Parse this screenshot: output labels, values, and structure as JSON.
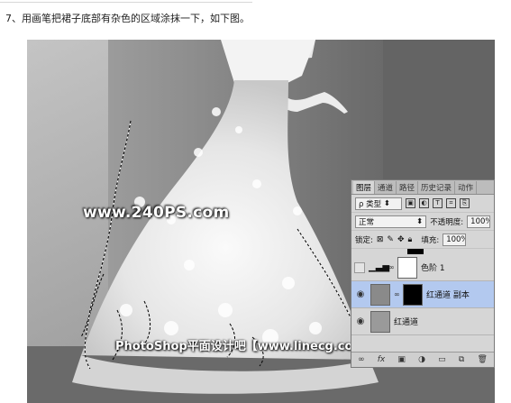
{
  "instruction": "7、用画笔把裙子底部有杂色的区域涂抹一下，如下图。",
  "watermark": "www.240PS.com",
  "footer_watermark": "PhotoShop平面设计吧【www.linecg.com/tieba/1783】",
  "panel": {
    "tabs": [
      "图层",
      "通道",
      "路径",
      "历史记录",
      "动作"
    ],
    "filter_label": "ρ 类型",
    "blend_mode": "正常",
    "opacity_label": "不透明度:",
    "opacity_value": "100%",
    "lock_label": "锁定:",
    "fill_label": "填充:",
    "fill_value": "100%",
    "layers": [
      {
        "name": "色阶 1",
        "visible": false
      },
      {
        "name": "红通道 副本",
        "visible": true,
        "selected": true
      },
      {
        "name": "红通道",
        "visible": true
      }
    ],
    "bottom_icons": [
      "link-icon",
      "fx-icon",
      "mask-icon",
      "adjustment-icon",
      "folder-icon",
      "new-layer-icon",
      "trash-icon"
    ]
  }
}
